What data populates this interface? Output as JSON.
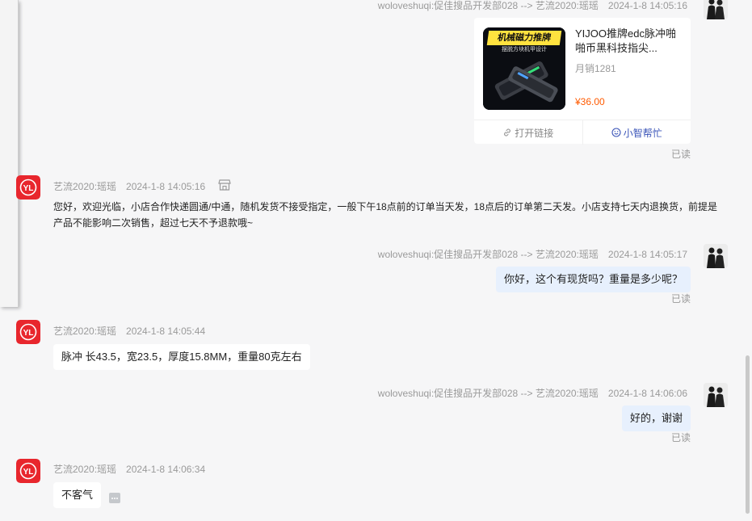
{
  "conversation": {
    "messages": [
      {
        "sender": "woloveshuqi:促佳搜品开发部028 --> 艺流2020:瑶瑶",
        "time": "2024-1-8 14:05:16",
        "type": "product_card",
        "product": {
          "thumb_banner": "机械磁力推牌",
          "thumb_subtitle": "摆脱方块机甲设计",
          "title": "YIJOO推牌edc脉冲啪啪币黑科技指尖...",
          "sales": "月销1281",
          "price": "¥36.00",
          "open_link_label": "打开链接",
          "helper_label": "小智帮忙"
        },
        "status": "已读"
      },
      {
        "sender": "艺流2020:瑶瑶",
        "time": "2024-1-8 14:05:16",
        "type": "text",
        "text_line1": "您好，欢迎光临，小店合作快递圆通/中通，随机发货不接受指定，一般下午18点前的订单当天发，18点后的订单第二天发。小店支持七天内退换货，前提是",
        "text_line2": "产品不能影响二次销售，超过七天不予退款哦~"
      },
      {
        "sender": "woloveshuqi:促佳搜品开发部028 --> 艺流2020:瑶瑶",
        "time": "2024-1-8 14:05:17",
        "type": "text",
        "text": "你好，这个有现货吗？重量是多少呢？",
        "status": "已读"
      },
      {
        "sender": "艺流2020:瑶瑶",
        "time": "2024-1-8 14:05:44",
        "type": "text",
        "text": "脉冲 长43.5，宽23.5，厚度15.8MM，重量80克左右"
      },
      {
        "sender": "woloveshuqi:促佳搜品开发部028 --> 艺流2020:瑶瑶",
        "time": "2024-1-8 14:06:06",
        "type": "text",
        "text": "好的，谢谢",
        "status": "已读"
      },
      {
        "sender": "艺流2020:瑶瑶",
        "time": "2024-1-8 14:06:34",
        "type": "text",
        "text": "不客气"
      }
    ]
  },
  "colors": {
    "background": "#f6f6f7",
    "outgoing_bubble": "#e7f0fd",
    "incoming_bubble": "#ffffff",
    "price": "#ff5a00",
    "helper_link": "#3a54b8",
    "shop_logo": "#e8262d"
  },
  "icons": {
    "store": "store-icon",
    "more": "more-options-icon",
    "link": "link-icon",
    "helper": "smile-icon"
  }
}
